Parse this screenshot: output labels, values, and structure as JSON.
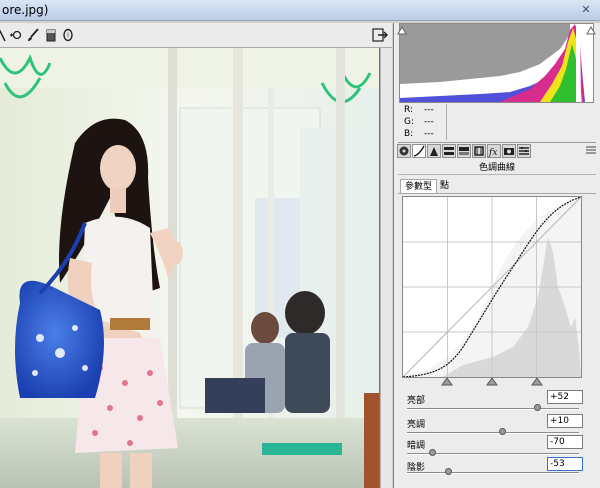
{
  "window": {
    "title": "ore.jpg)"
  },
  "toolbar": {
    "tools": [
      "crop-tool-icon",
      "red-eye-tool-icon",
      "brush-tool-icon",
      "filter-tool-icon",
      "radial-tool-icon"
    ],
    "export_icon": "export-icon"
  },
  "rgb_readout": [
    {
      "key": "R:",
      "value": "---"
    },
    {
      "key": "G:",
      "value": "---"
    },
    {
      "key": "B:",
      "value": "---"
    }
  ],
  "panel_tabs": [
    "basic",
    "tone-curve",
    "detail",
    "hsl",
    "split-toning",
    "lens",
    "fx",
    "camera",
    "presets"
  ],
  "tone_curve": {
    "title": "色調曲線",
    "tabs": [
      {
        "label": "參數型",
        "active": true
      },
      {
        "label": "點",
        "active": false
      }
    ],
    "controls": [
      {
        "label": "亮部",
        "value": "+52",
        "level": 0.76
      },
      {
        "label": "亮調",
        "value": "+10",
        "level": 0.55
      },
      {
        "label": "暗調",
        "value": "-70",
        "level": 0.15
      },
      {
        "label": "陰影",
        "value": "-53",
        "level": 0.24
      }
    ],
    "split_points": [
      0.25,
      0.5,
      0.75
    ]
  },
  "colors": {
    "accent": "#3a6ecf",
    "panel_bg": "#ececec",
    "curve_line": "#000000",
    "histogram_fill": "#d9d9d9"
  }
}
